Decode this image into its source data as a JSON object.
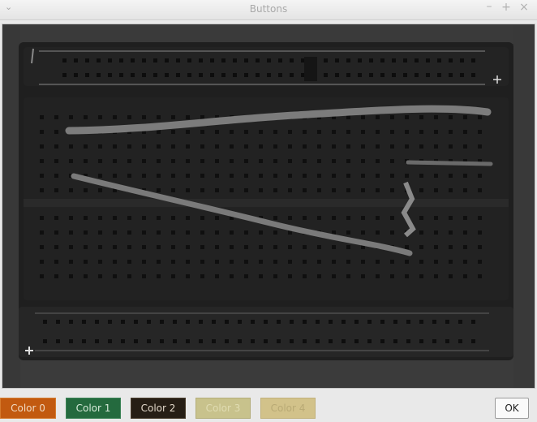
{
  "window": {
    "title": "Buttons",
    "menu_glyph": "⌄",
    "minimize_glyph": "–",
    "maximize_glyph": "+",
    "close_glyph": "×"
  },
  "canvas": {
    "image_description_icon": "breadboard-photo-image"
  },
  "buttons": {
    "color0_label": "Color 0",
    "color1_label": "Color 1",
    "color2_label": "Color 2",
    "color3_label": "Color 3",
    "color4_label": "Color 4",
    "ok_label": "OK"
  },
  "colors": {
    "color0": "#c25a10",
    "color1": "#246a3e",
    "color2": "#261e15",
    "color3": "#c8c28c",
    "color4": "#d2c28a"
  }
}
